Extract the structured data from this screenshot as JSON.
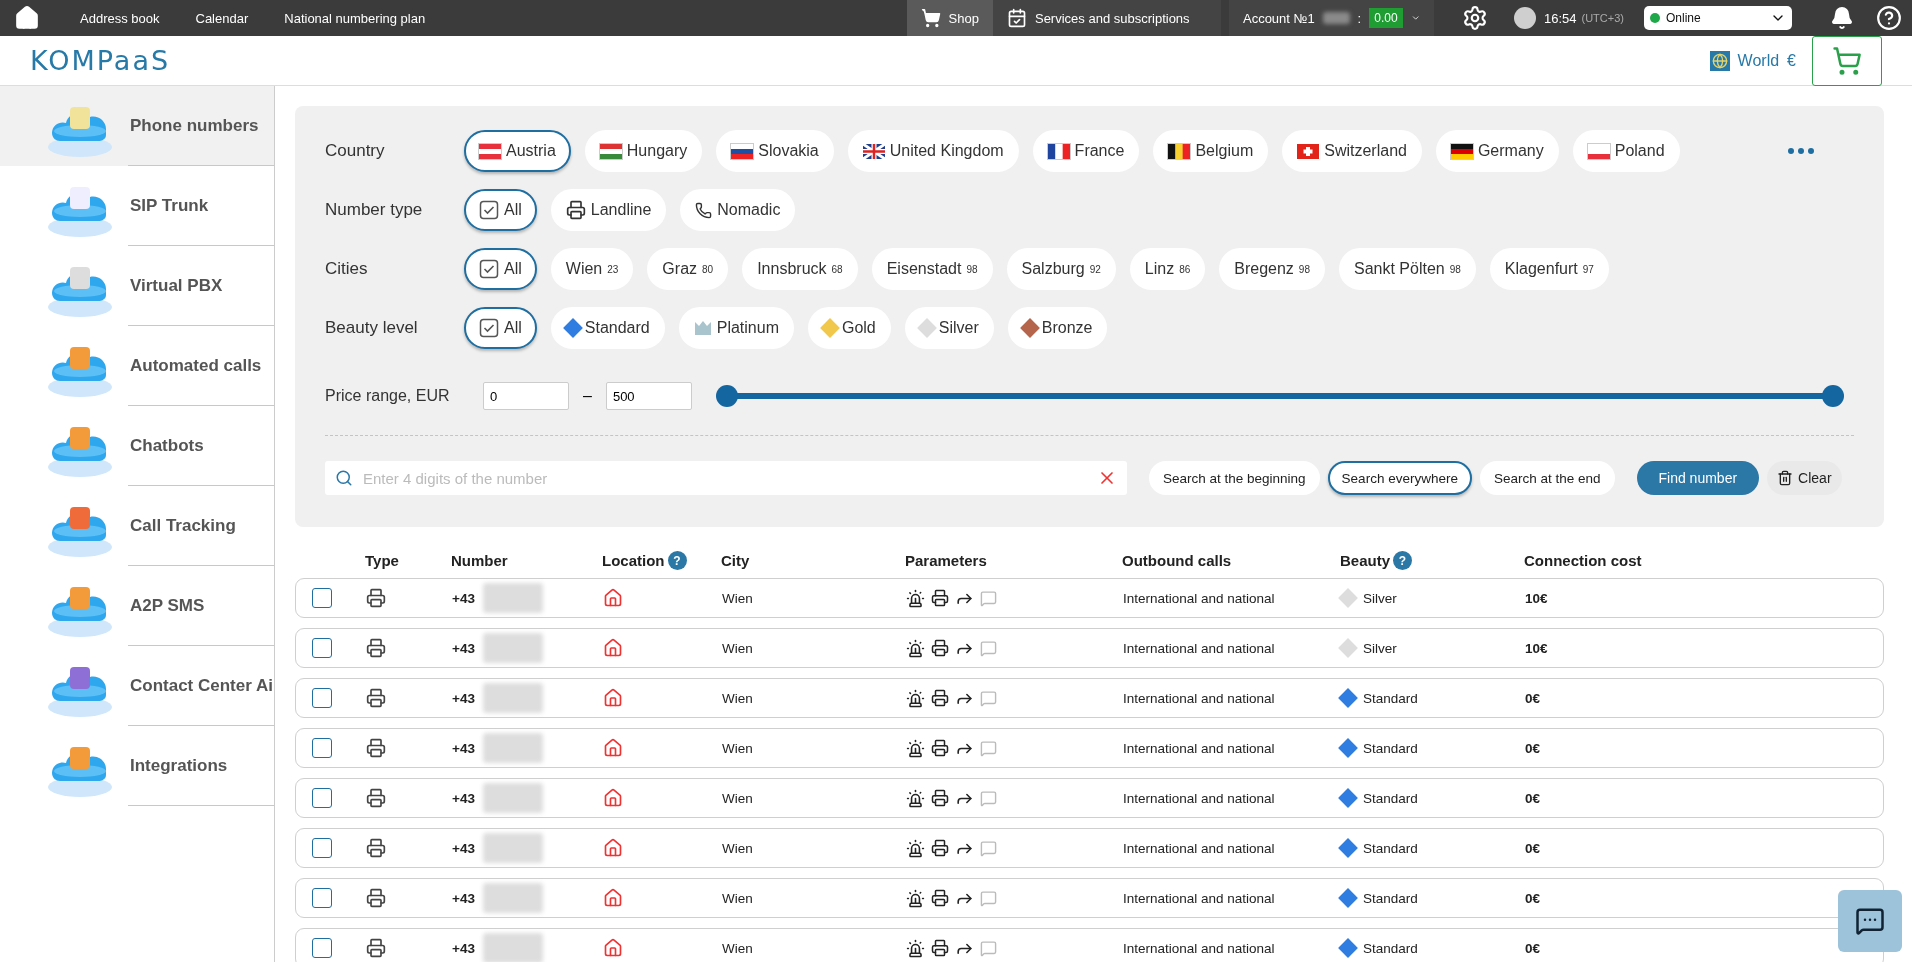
{
  "topbar": {
    "links": [
      {
        "label": "Address book"
      },
      {
        "label": "Calendar"
      },
      {
        "label": "National numbering plan"
      }
    ],
    "shop": {
      "label": "Shop",
      "selected": true
    },
    "services": {
      "label": "Services and subscriptions",
      "selected": false
    },
    "account": {
      "label": "Account №1",
      "separator": ":",
      "balance": "0.00"
    },
    "time": "16:54",
    "timezone": "(UTC+3)",
    "status": {
      "value": "Online",
      "color": "#1fa84a"
    }
  },
  "header": {
    "logo": "KOMPaaS",
    "region": "World",
    "currency": "€"
  },
  "sidebar": {
    "items": [
      {
        "label": "Phone numbers",
        "selected": true
      },
      {
        "label": "SIP Trunk",
        "selected": false
      },
      {
        "label": "Virtual PBX",
        "selected": false
      },
      {
        "label": "Automated calls",
        "selected": false
      },
      {
        "label": "Chatbots",
        "selected": false
      },
      {
        "label": "Call Tracking",
        "selected": false
      },
      {
        "label": "A2P SMS",
        "selected": false
      },
      {
        "label": "Contact Center Ai",
        "selected": false
      },
      {
        "label": "Integrations",
        "selected": false
      }
    ]
  },
  "filters": {
    "country": {
      "label": "Country",
      "options": [
        {
          "label": "Austria",
          "selected": true
        },
        {
          "label": "Hungary",
          "selected": false
        },
        {
          "label": "Slovakia",
          "selected": false
        },
        {
          "label": "United Kingdom",
          "selected": false
        },
        {
          "label": "France",
          "selected": false
        },
        {
          "label": "Belgium",
          "selected": false
        },
        {
          "label": "Switzerland",
          "selected": false
        },
        {
          "label": "Germany",
          "selected": false
        },
        {
          "label": "Poland",
          "selected": false
        }
      ]
    },
    "number_type": {
      "label": "Number type",
      "options": [
        {
          "label": "All",
          "kind": "check",
          "selected": true
        },
        {
          "label": "Landline",
          "kind": "landline",
          "selected": false
        },
        {
          "label": "Nomadic",
          "kind": "phone",
          "selected": false
        }
      ]
    },
    "cities": {
      "label": "Cities",
      "options": [
        {
          "label": "All",
          "kind": "check",
          "selected": true
        },
        {
          "label": "Wien",
          "count": "23",
          "selected": false
        },
        {
          "label": "Graz",
          "count": "80",
          "selected": false
        },
        {
          "label": "Innsbruck",
          "count": "68",
          "selected": false
        },
        {
          "label": "Eisenstadt",
          "count": "98",
          "selected": false
        },
        {
          "label": "Salzburg",
          "count": "92",
          "selected": false
        },
        {
          "label": "Linz",
          "count": "86",
          "selected": false
        },
        {
          "label": "Bregenz",
          "count": "98",
          "selected": false
        },
        {
          "label": "Sankt Pölten",
          "count": "98",
          "selected": false
        },
        {
          "label": "Klagenfurt",
          "count": "97",
          "selected": false
        }
      ]
    },
    "beauty": {
      "label": "Beauty level",
      "options": [
        {
          "label": "All",
          "kind": "check",
          "selected": true
        },
        {
          "label": "Standard",
          "kind": "diamond",
          "color": "#2f7de1",
          "selected": false
        },
        {
          "label": "Platinum",
          "kind": "crown",
          "color": "#a9c4cc",
          "selected": false
        },
        {
          "label": "Gold",
          "kind": "diamond",
          "color": "#f1c84b",
          "selected": false
        },
        {
          "label": "Silver",
          "kind": "diamond",
          "color": "#dddddd",
          "selected": false
        },
        {
          "label": "Bronze",
          "kind": "diamond",
          "color": "#b5654c",
          "selected": false
        }
      ]
    },
    "price": {
      "label": "Price range, EUR",
      "from": "0",
      "separator": "–",
      "to": "500",
      "thumbs": [
        {
          "level": 0
        },
        {
          "level": 1
        }
      ]
    },
    "search": {
      "placeholder": "Enter 4 digits of the number",
      "modes": [
        {
          "label": "Search at the beginning",
          "selected": false
        },
        {
          "label": "Search everywhere",
          "selected": true
        },
        {
          "label": "Search at the end",
          "selected": false
        }
      ],
      "find": "Find number",
      "clear": "Clear"
    }
  },
  "table": {
    "columns": [
      {
        "label": "Type"
      },
      {
        "label": "Number"
      },
      {
        "label": "Location",
        "help": "?"
      },
      {
        "label": "City"
      },
      {
        "label": "Parameters"
      },
      {
        "label": "Outbound calls"
      },
      {
        "label": "Beauty",
        "help": "?"
      },
      {
        "label": "Connection cost"
      }
    ],
    "rows": [
      {
        "checked": false,
        "number": "+43",
        "city": "Wien",
        "outbound": "International and national",
        "beauty": "Silver",
        "color": "#dddddd",
        "cost": "10€"
      },
      {
        "checked": false,
        "number": "+43",
        "city": "Wien",
        "outbound": "International and national",
        "beauty": "Silver",
        "color": "#dddddd",
        "cost": "10€"
      },
      {
        "checked": false,
        "number": "+43",
        "city": "Wien",
        "outbound": "International and national",
        "beauty": "Standard",
        "color": "#2f7de1",
        "cost": "0€"
      },
      {
        "checked": false,
        "number": "+43",
        "city": "Wien",
        "outbound": "International and national",
        "beauty": "Standard",
        "color": "#2f7de1",
        "cost": "0€"
      },
      {
        "checked": false,
        "number": "+43",
        "city": "Wien",
        "outbound": "International and national",
        "beauty": "Standard",
        "color": "#2f7de1",
        "cost": "0€"
      },
      {
        "checked": false,
        "number": "+43",
        "city": "Wien",
        "outbound": "International and national",
        "beauty": "Standard",
        "color": "#2f7de1",
        "cost": "0€"
      },
      {
        "checked": false,
        "number": "+43",
        "city": "Wien",
        "outbound": "International and national",
        "beauty": "Standard",
        "color": "#2f7de1",
        "cost": "0€"
      },
      {
        "checked": false,
        "number": "+43",
        "city": "Wien",
        "outbound": "International and national",
        "beauty": "Standard",
        "color": "#2f7de1",
        "cost": "0€"
      }
    ]
  }
}
